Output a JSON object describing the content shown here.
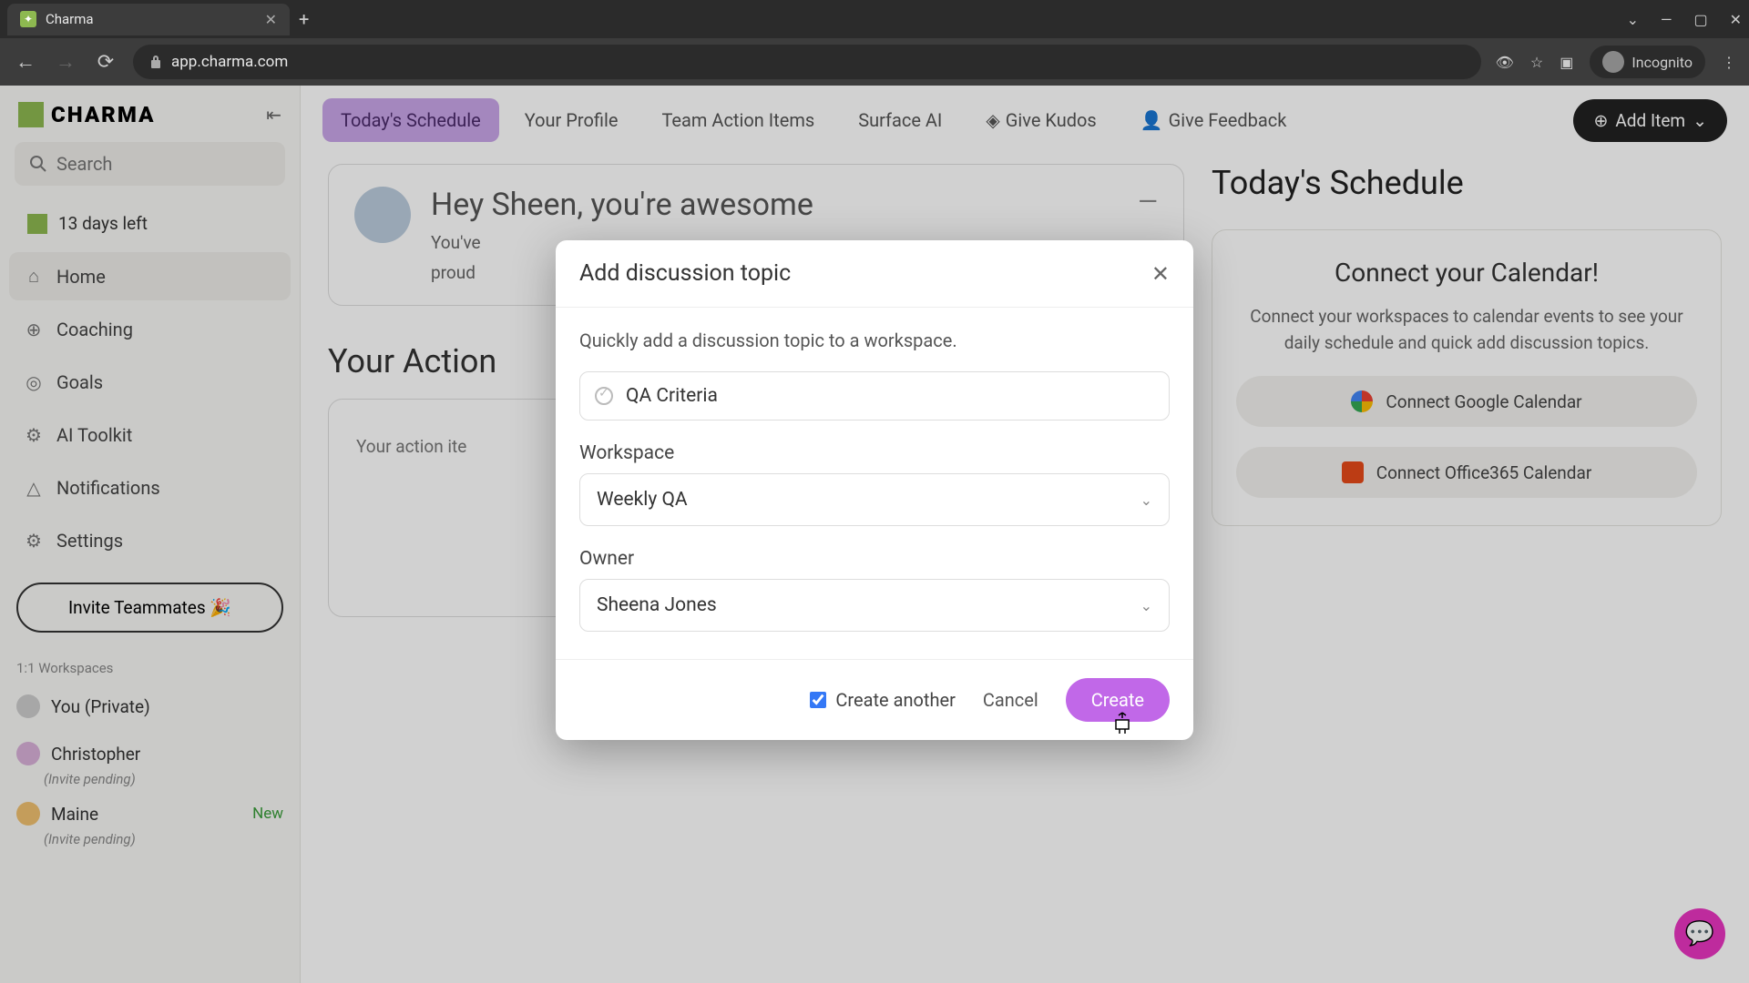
{
  "browser": {
    "tab_title": "Charma",
    "url": "app.charma.com",
    "incognito_label": "Incognito"
  },
  "sidebar": {
    "logo_text": "CHARMA",
    "search_placeholder": "Search",
    "trial_text": "13 days left",
    "nav": [
      {
        "label": "Home",
        "icon": "⌂"
      },
      {
        "label": "Coaching",
        "icon": "⊕"
      },
      {
        "label": "Goals",
        "icon": "◎"
      },
      {
        "label": "AI Toolkit",
        "icon": "⚙"
      },
      {
        "label": "Notifications",
        "icon": "△"
      },
      {
        "label": "Settings",
        "icon": "⚙"
      }
    ],
    "invite_label": "Invite Teammates 🎉",
    "ws_header": "1:1 Workspaces",
    "workspaces": [
      {
        "name": "You (Private)",
        "pending": "",
        "new": ""
      },
      {
        "name": "Christopher",
        "pending": "(Invite pending)",
        "new": ""
      },
      {
        "name": "Maine",
        "pending": "(Invite pending)",
        "new": "New"
      }
    ]
  },
  "topbar": {
    "tabs": [
      "Today's Schedule",
      "Your Profile",
      "Team Action Items",
      "Surface AI",
      "Give Kudos",
      "Give Feedback"
    ],
    "add_item_label": "Add Item"
  },
  "greeting": {
    "title": "Hey Sheen, you're awesome",
    "sub_line1": "You've",
    "sub_line2": "proud"
  },
  "action": {
    "heading": "Your Action",
    "empty_text": "Your action ite"
  },
  "schedule": {
    "heading": "Today's Schedule",
    "cal_heading": "Connect your Calendar!",
    "cal_sub": "Connect your workspaces to calendar events to see your daily schedule and quick add discussion topics.",
    "google_btn": "Connect Google Calendar",
    "office_btn": "Connect Office365 Calendar"
  },
  "modal": {
    "title": "Add discussion topic",
    "description": "Quickly add a discussion topic to a workspace.",
    "topic_value": "QA Criteria",
    "workspace_label": "Workspace",
    "workspace_value": "Weekly QA",
    "owner_label": "Owner",
    "owner_value": "Sheena Jones",
    "create_another_label": "Create another",
    "cancel_label": "Cancel",
    "create_label": "Create"
  }
}
